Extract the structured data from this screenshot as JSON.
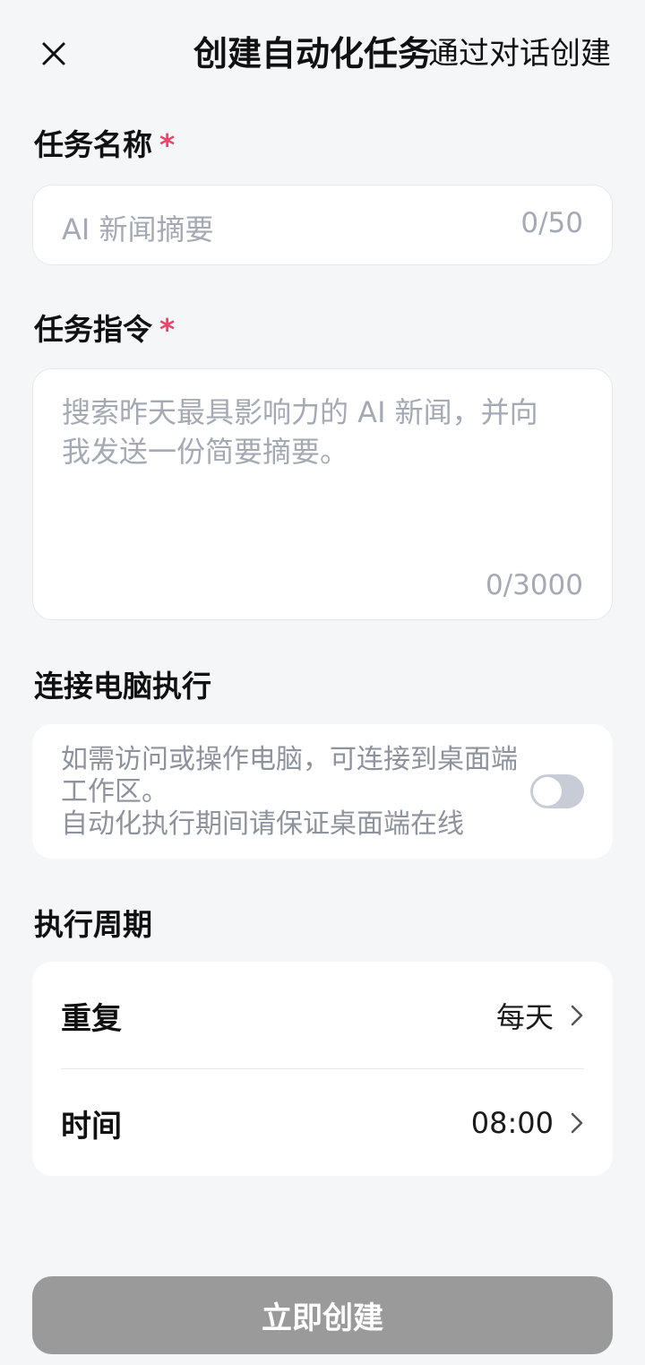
{
  "header": {
    "title": "创建自动化任务",
    "dialog_create_label": "通过对话创建"
  },
  "task_name": {
    "label": "任务名称",
    "required_mark": "*",
    "placeholder": "AI 新闻摘要",
    "counter": "0/50"
  },
  "task_instruction": {
    "label": "任务指令",
    "required_mark": "*",
    "placeholder": "搜索昨天最具影响力的 AI 新闻，并向我发送一份简要摘要。",
    "counter": "0/3000"
  },
  "computer_exec": {
    "label": "连接电脑执行",
    "description_line1": "如需访问或操作电脑，可连接到桌面端工作区。",
    "description_line2": "自动化执行期间请保证桌面端在线",
    "toggle_on": false
  },
  "schedule": {
    "label": "执行周期",
    "repeat_label": "重复",
    "repeat_value": "每天",
    "time_label": "时间",
    "time_value": "08:00"
  },
  "submit": {
    "label": "立即创建"
  },
  "colors": {
    "required": "#e8456b",
    "submit_disabled": "#9a9a9a",
    "toggle_off": "#c7ccd6"
  },
  "icons": {
    "close": "close-icon",
    "chevron": "chevron-right-icon"
  }
}
